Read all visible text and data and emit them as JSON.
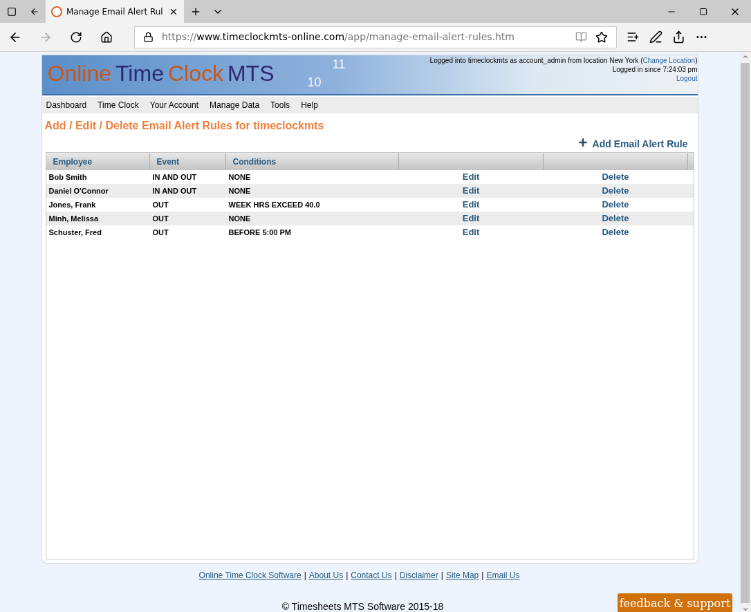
{
  "browser": {
    "tab_title": "Manage Email Alert Rul",
    "url_prefix": "https://",
    "url_host": "www.timeclockmts-online.com",
    "url_path": "/app/manage-email-alert-rules.htm"
  },
  "banner": {
    "logo_parts": [
      {
        "text": "Online",
        "color": "#c8561a"
      },
      {
        "text": "Time",
        "color": "#2e2870"
      },
      {
        "text": "Clock",
        "color": "#c8561a"
      },
      {
        "text": "MTS",
        "color": "#2e2870"
      }
    ],
    "clock_numerals": [
      "11",
      "10"
    ],
    "login_prefix": "Logged into timeclockmts as account_admin from location New York (",
    "login_link": "Change Location",
    "login_suffix": ")",
    "since": "Logged in since 7:24:03 pm",
    "logout": "Logout"
  },
  "nav": [
    "Dashboard",
    "Time Clock",
    "Your Account",
    "Manage Data",
    "Tools",
    "Help"
  ],
  "page_title": "Add / Edit / Delete Email Alert Rules for timeclockmts",
  "add_link": "Add Email Alert Rule",
  "table": {
    "columns": [
      "Employee",
      "Event",
      "Conditions"
    ],
    "rows": [
      {
        "employee": "Bob Smith",
        "event": "IN AND OUT",
        "conditions": "NONE",
        "edit": "Edit",
        "delete": "Delete"
      },
      {
        "employee": "Daniel O'Connor",
        "event": "IN AND OUT",
        "conditions": "NONE",
        "edit": "Edit",
        "delete": "Delete"
      },
      {
        "employee": "Jones, Frank",
        "event": "OUT",
        "conditions": "WEEK HRS EXCEED 40.0",
        "edit": "Edit",
        "delete": "Delete"
      },
      {
        "employee": "Minh, Melissa",
        "event": "OUT",
        "conditions": "NONE",
        "edit": "Edit",
        "delete": "Delete"
      },
      {
        "employee": "Schuster, Fred",
        "event": "OUT",
        "conditions": "BEFORE 5:00 PM",
        "edit": "Edit",
        "delete": "Delete"
      }
    ]
  },
  "footer": {
    "links": [
      "Online Time Clock Software",
      "About Us",
      "Contact Us",
      "Disclaimer",
      "Site Map",
      "Email Us"
    ],
    "separator": "|",
    "copyright": "© Timesheets MTS Software 2015-18"
  },
  "feedback": "feedback & support"
}
